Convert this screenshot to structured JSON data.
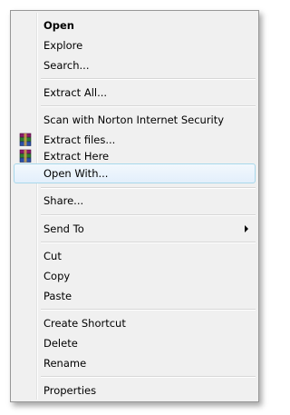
{
  "menu": {
    "open": "Open",
    "explore": "Explore",
    "search": "Search...",
    "extract_all": "Extract All...",
    "scan_norton": "Scan with Norton Internet Security",
    "extract_files": "Extract files...",
    "extract_here": "Extract Here",
    "open_with": "Open With...",
    "share": "Share...",
    "send_to": "Send To",
    "cut": "Cut",
    "copy": "Copy",
    "paste": "Paste",
    "create_shortcut": "Create Shortcut",
    "delete": "Delete",
    "rename": "Rename",
    "properties": "Properties"
  },
  "icons": {
    "extract_files": "winrar-icon",
    "extract_here": "winrar-icon",
    "send_to": "submenu-arrow-icon"
  },
  "colors": {
    "menu_background": "#f0f0f0",
    "hover_border": "#a8d8eb",
    "hover_fill": "#e3effb"
  }
}
